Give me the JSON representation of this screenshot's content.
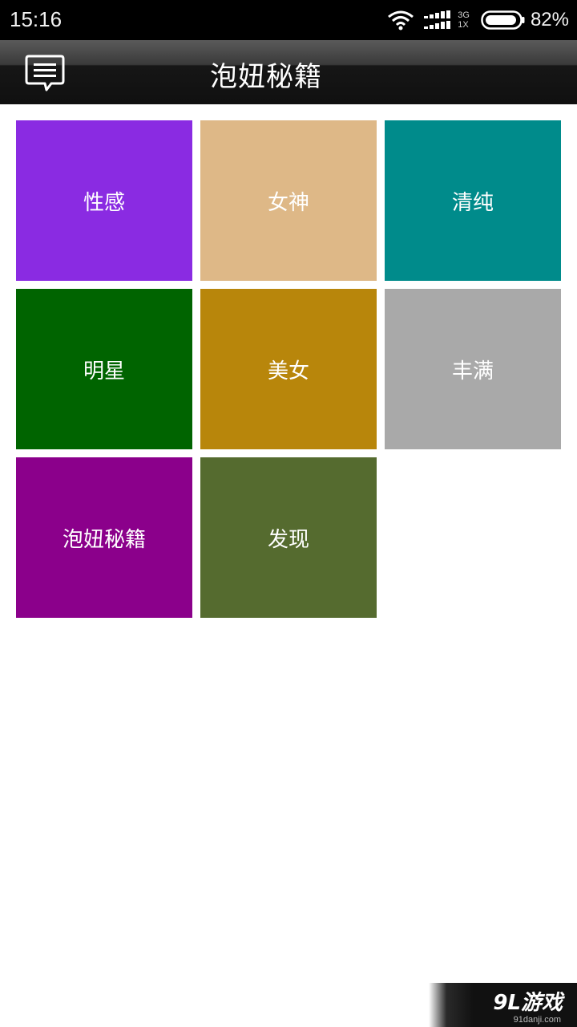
{
  "status_bar": {
    "time": "15:16",
    "network_top": "3G",
    "network_bottom": "1X",
    "battery_percent": "82%"
  },
  "header": {
    "title": "泡妞秘籍",
    "menu_icon": "message-list-icon"
  },
  "tiles": [
    {
      "label": "性感",
      "color": "#8a2be2"
    },
    {
      "label": "女神",
      "color": "#deb887"
    },
    {
      "label": "清纯",
      "color": "#008b8b"
    },
    {
      "label": "明星",
      "color": "#006400"
    },
    {
      "label": "美女",
      "color": "#b8860b"
    },
    {
      "label": "丰满",
      "color": "#a9a9a9"
    },
    {
      "label": "泡妞秘籍",
      "color": "#8b008b"
    },
    {
      "label": "发现",
      "color": "#556b2f"
    }
  ],
  "watermark": {
    "logo": "9L游戏",
    "url": "91danji.com"
  }
}
